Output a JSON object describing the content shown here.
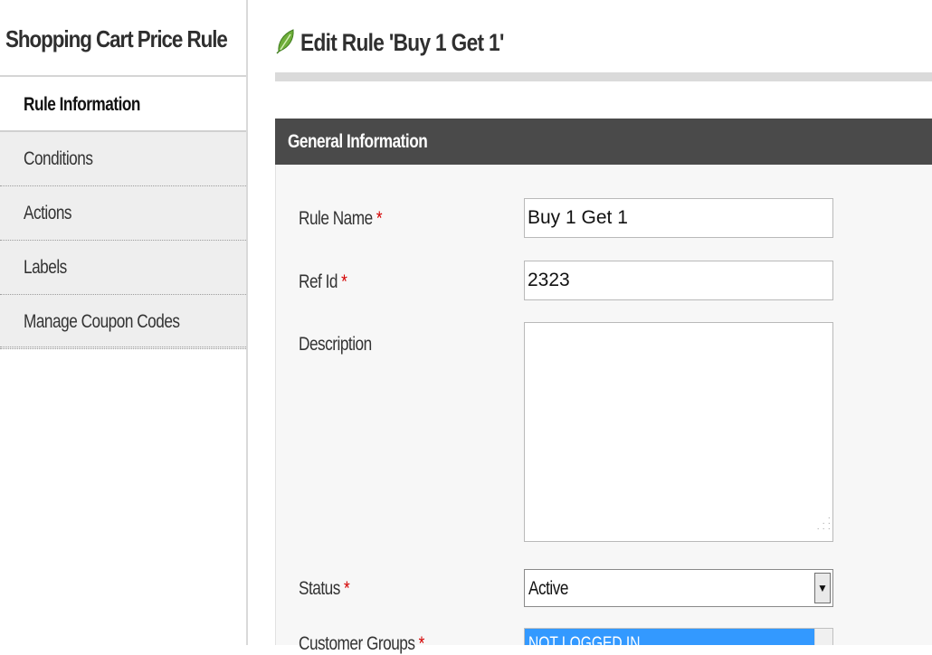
{
  "sidebar": {
    "title": "Shopping Cart Price Rule",
    "tabs": [
      {
        "label": "Rule Information",
        "active": true
      },
      {
        "label": "Conditions",
        "active": false
      },
      {
        "label": "Actions",
        "active": false
      },
      {
        "label": "Labels",
        "active": false
      },
      {
        "label": "Manage Coupon Codes",
        "active": false
      }
    ]
  },
  "header": {
    "icon": "edit-leaf-icon",
    "title": "Edit Rule 'Buy 1 Get 1'"
  },
  "section": {
    "title": "General Information",
    "required_mark": "*",
    "fields": {
      "rule_name": {
        "label": "Rule Name",
        "value": "Buy 1 Get 1"
      },
      "ref_id": {
        "label": "Ref Id",
        "value": "2323"
      },
      "description": {
        "label": "Description",
        "value": ""
      },
      "status": {
        "label": "Status",
        "value": "Active"
      },
      "customer_groups": {
        "label": "Customer Groups",
        "selected_option": "NOT LOGGED IN"
      }
    }
  },
  "colors": {
    "section_header_bg": "#4a4a4a",
    "required": "#d40000",
    "selected_option_bg": "#3399ff",
    "icon_green": "#6fae3a"
  }
}
